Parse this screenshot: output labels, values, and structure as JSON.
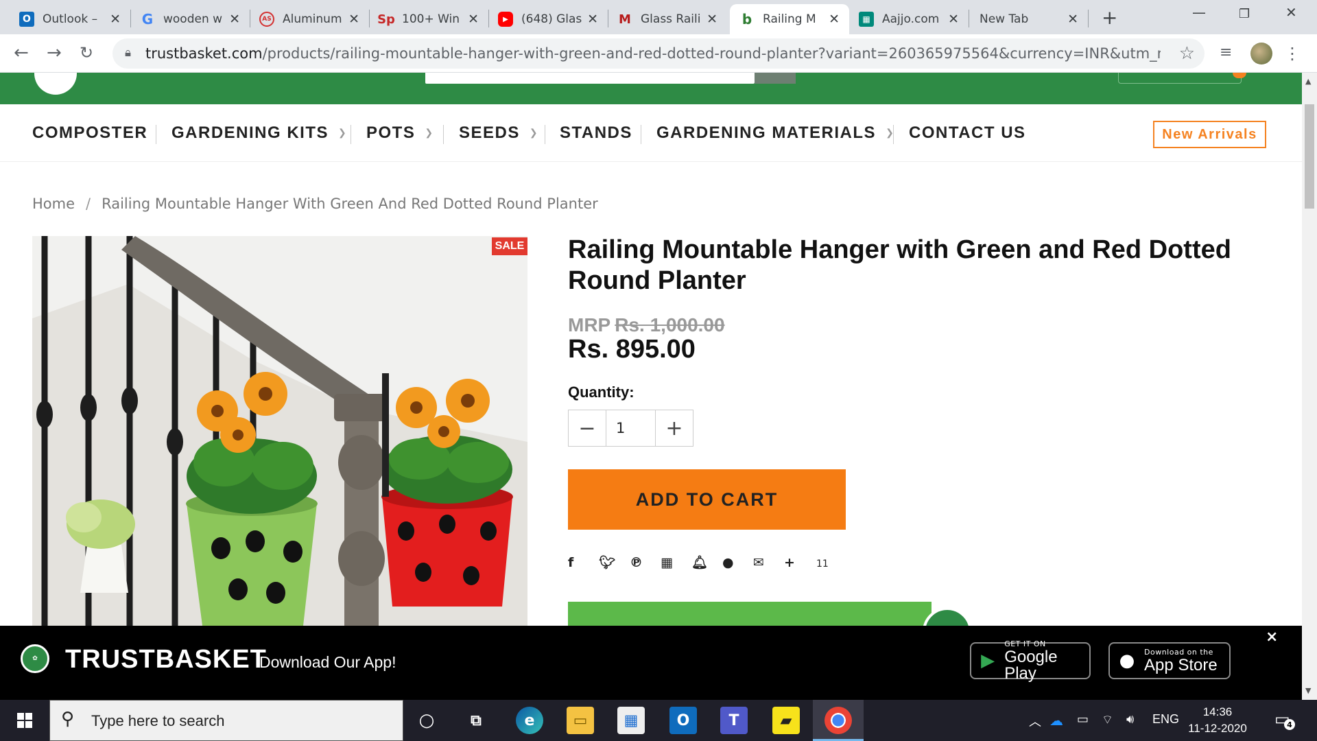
{
  "browser": {
    "tabs": [
      {
        "title": "Outlook –",
        "icon": "outlook-icon",
        "color": "#0f6cbd"
      },
      {
        "title": "wooden w",
        "icon": "google-icon",
        "color": "#4285f4"
      },
      {
        "title": "Aluminum",
        "icon": "aluminium-site-icon",
        "color": "#d32f2f"
      },
      {
        "title": "100+ Win",
        "icon": "sp-icon",
        "color": "#c62828"
      },
      {
        "title": "(648) Glas",
        "icon": "youtube-icon",
        "color": "#ff0000"
      },
      {
        "title": "Glass Raili",
        "icon": "glass-site-icon",
        "color": "#b71c1c"
      },
      {
        "title": "Railing M",
        "icon": "trustbasket-icon",
        "color": "#2e7d32"
      },
      {
        "title": "Aajjo.com",
        "icon": "aajjo-icon",
        "color": "#00897b"
      },
      {
        "title": "New Tab",
        "icon": "",
        "color": ""
      }
    ],
    "url_domain": "trustbasket.com",
    "url_path": "/products/railing-mountable-hanger-with-green-and-red-dotted-round-planter?variant=260365975564&currency=INR&utm_medium=produ..."
  },
  "site": {
    "nav": [
      {
        "label": "COMPOSTER",
        "dropdown": false
      },
      {
        "label": "GARDENING KITS",
        "dropdown": true
      },
      {
        "label": "POTS",
        "dropdown": true
      },
      {
        "label": "SEEDS",
        "dropdown": true
      },
      {
        "label": "STANDS",
        "dropdown": false
      },
      {
        "label": "GARDENING MATERIALS",
        "dropdown": true
      },
      {
        "label": "CONTACT US",
        "dropdown": false
      }
    ],
    "new_arrivals": "New Arrivals",
    "breadcrumb": {
      "home": "Home",
      "separator": "/",
      "current": "Railing Mountable Hanger With Green And Red Dotted Round Planter"
    },
    "product": {
      "sale_badge": "SALE",
      "title": "Railing Mountable Hanger with Green and Red Dotted Round Planter",
      "mrp_label": "MRP",
      "mrp_value": "Rs. 1,000.00",
      "price": "Rs. 895.00",
      "quantity_label": "Quantity:",
      "quantity_value": "1",
      "minus": "−",
      "plus": "+",
      "add_to_cart": "ADD TO CART",
      "share_more_plus": "+",
      "share_more_count": "11"
    },
    "app_banner": {
      "brand": "TRUSTBASKET",
      "subtitle": "Download Our App!",
      "google_small": "GET IT ON",
      "google_big": "Google Play",
      "apple_small": "Download on the",
      "apple_big": "App Store",
      "close": "×"
    },
    "accent_green": "#2e8b45",
    "accent_orange": "#f57c13"
  },
  "taskbar": {
    "search_placeholder": "Type here to search",
    "language": "ENG",
    "time": "14:36",
    "date": "11-12-2020",
    "notification_count": "4"
  }
}
